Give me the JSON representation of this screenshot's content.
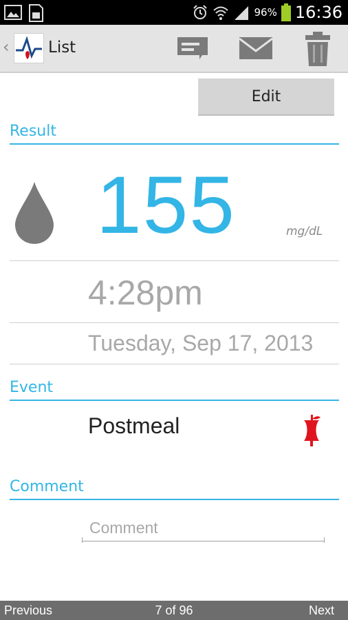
{
  "status_bar": {
    "battery_percent": "96%",
    "time": "16:36",
    "icons": [
      "picture-icon",
      "sim-card-icon",
      "alarm-icon",
      "wifi-icon",
      "signal-icon",
      "battery-icon"
    ]
  },
  "action_bar": {
    "title": "List",
    "actions": [
      "message-icon",
      "mail-icon",
      "trash-icon"
    ]
  },
  "edit_label": "Edit",
  "result": {
    "header": "Result",
    "value": "155",
    "unit": "mg/dL",
    "time": "4:28pm",
    "date": "Tuesday, Sep 17, 2013"
  },
  "event": {
    "header": "Event",
    "value": "Postmeal",
    "icon": "apple-core-icon"
  },
  "comment": {
    "header": "Comment",
    "placeholder": "Comment",
    "value": ""
  },
  "navigation": {
    "previous": "Previous",
    "position": "7 of 96",
    "next": "Next"
  },
  "colors": {
    "accent": "#33b5e5",
    "apple": "#e0141e",
    "action_bar": "#e4e4e4",
    "bottom_bar": "#6d6d6d"
  }
}
